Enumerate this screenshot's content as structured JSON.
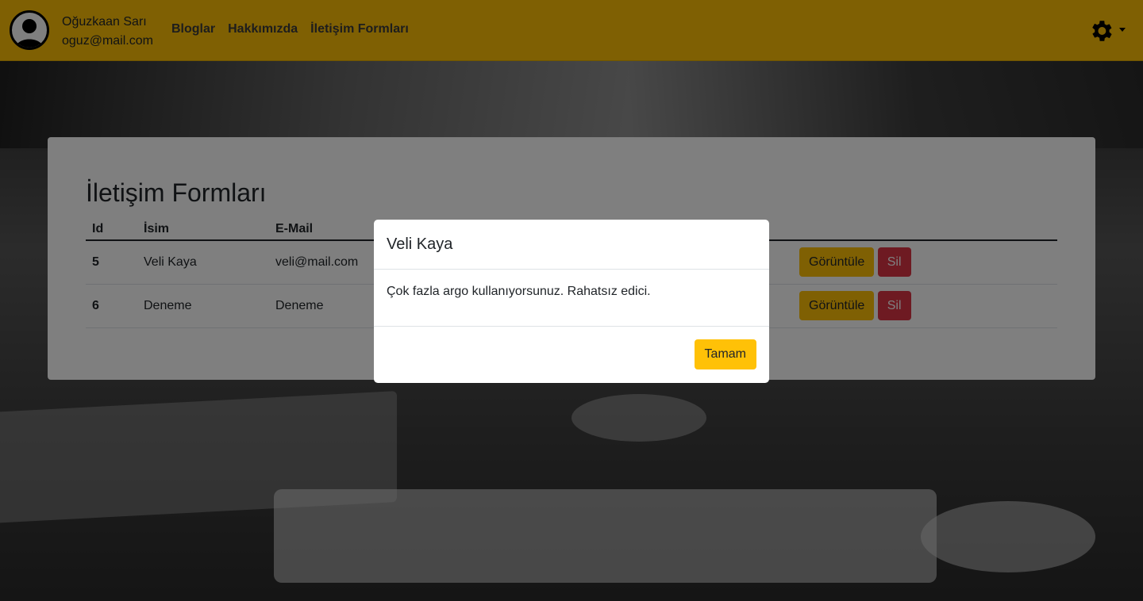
{
  "navbar": {
    "user_name": "Oğuzkaan Sarı",
    "user_email": "oguz@mail.com",
    "links": [
      "Bloglar",
      "Hakkımızda",
      "İletişim Formları"
    ]
  },
  "page": {
    "title": "İletişim Formları",
    "columns": [
      "Id",
      "İsim",
      "E-Mail"
    ],
    "rows": [
      {
        "id": "5",
        "name": "Veli Kaya",
        "email": "veli@mail.com",
        "view": "Görüntüle",
        "delete": "Sil"
      },
      {
        "id": "6",
        "name": "Deneme",
        "email": "Deneme",
        "view": "Görüntüle",
        "delete": "Sil"
      }
    ]
  },
  "modal": {
    "title": "Veli Kaya",
    "message": "Çok fazla argo kullanıyorsunuz. Rahatsız edici.",
    "ok": "Tamam"
  },
  "colors": {
    "navbar": "#ffc107",
    "warning": "#ffc107",
    "danger": "#dc3545"
  },
  "icons": [
    "user-avatar-icon",
    "gear-icon",
    "caret-down-icon"
  ]
}
